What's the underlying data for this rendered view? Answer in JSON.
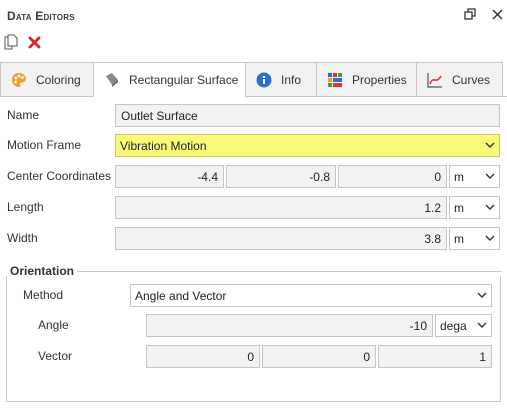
{
  "window": {
    "title": "Data Editors"
  },
  "tabs": [
    {
      "label": "Coloring",
      "icon": "palette-icon"
    },
    {
      "label": "Rectangular Surface",
      "icon": "surface-icon"
    },
    {
      "label": "Info",
      "icon": "info-icon"
    },
    {
      "label": "Properties",
      "icon": "properties-icon"
    },
    {
      "label": "Curves",
      "icon": "curves-icon"
    }
  ],
  "form": {
    "name": {
      "label": "Name",
      "value": "Outlet Surface"
    },
    "motion_frame": {
      "label": "Motion Frame",
      "value": "Vibration Motion"
    },
    "center": {
      "label": "Center Coordinates",
      "x": "-4.4",
      "y": "-0.8",
      "z": "0",
      "unit": "m"
    },
    "length": {
      "label": "Length",
      "value": "1.2",
      "unit": "m"
    },
    "width": {
      "label": "Width",
      "value": "3.8",
      "unit": "m"
    }
  },
  "orientation": {
    "title": "Orientation",
    "method": {
      "label": "Method",
      "value": "Angle and Vector"
    },
    "angle": {
      "label": "Angle",
      "value": "-10",
      "unit": "dega"
    },
    "vector": {
      "label": "Vector",
      "x": "0",
      "y": "0",
      "z": "1"
    }
  },
  "colors": {
    "highlight": "#fafa7a",
    "delete": "#e02020"
  }
}
